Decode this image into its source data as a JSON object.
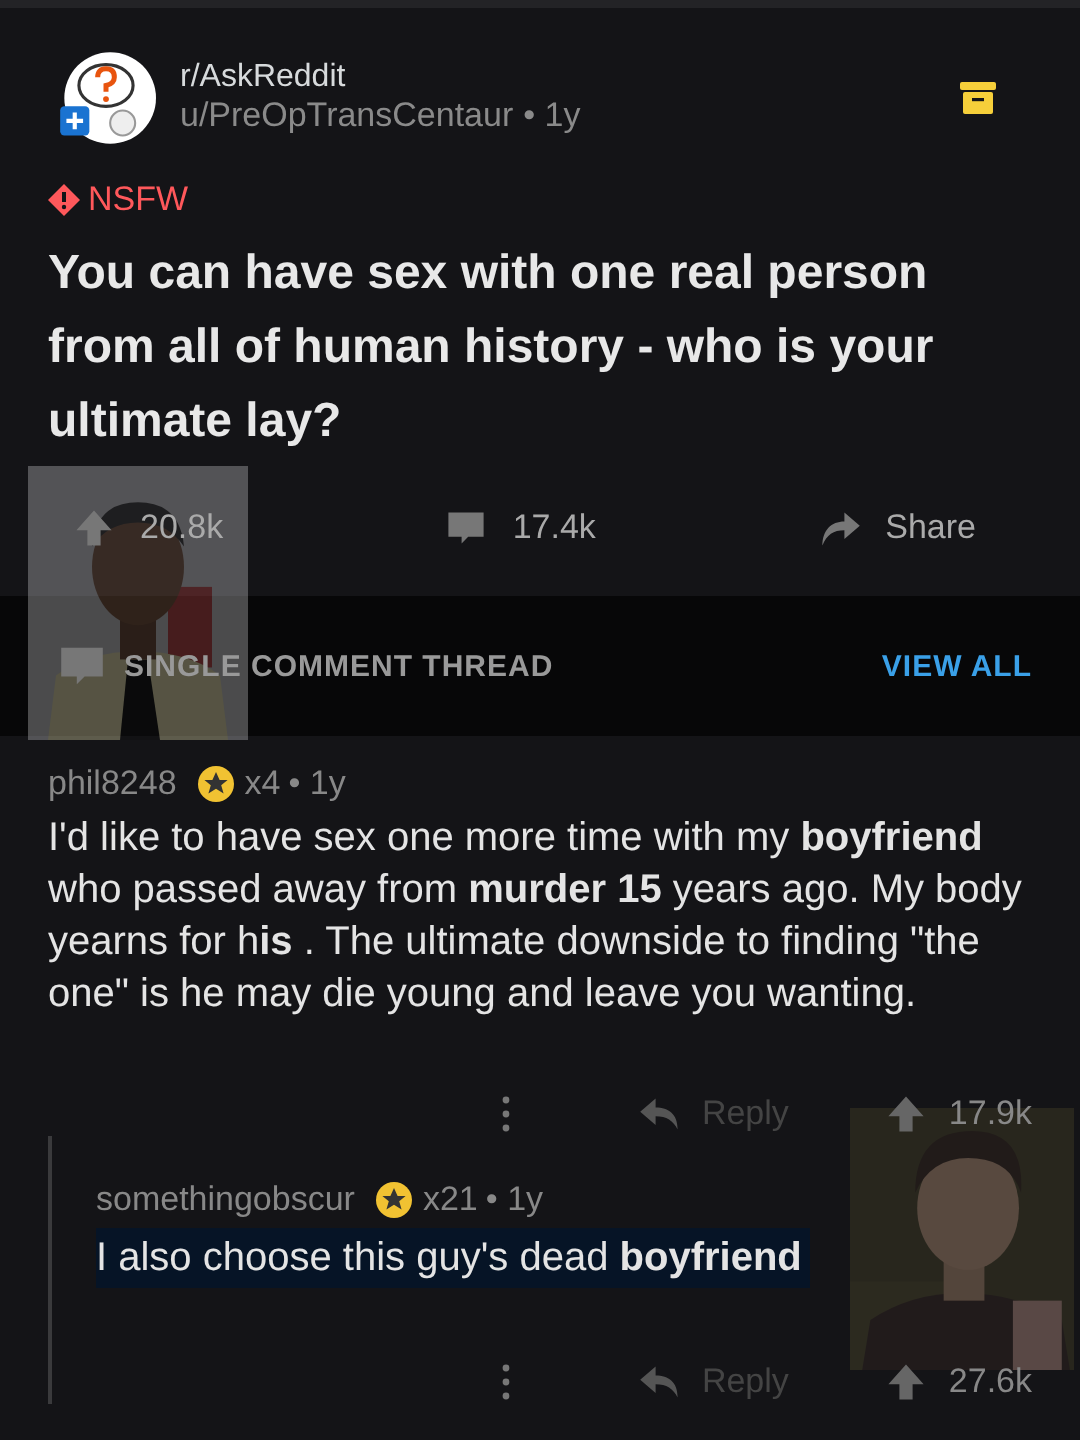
{
  "post": {
    "subreddit": "r/AskReddit",
    "author": "u/PreOpTransCentaur",
    "age": "• 1y",
    "nsfw": "NSFW",
    "title": "You can have sex with one real person from all of human history - who is your ultimate lay?",
    "votes": "20.8k",
    "comments": "17.4k",
    "share": "Share"
  },
  "thread_bar": {
    "label": "SINGLE COMMENT THREAD",
    "view_all": "VIEW ALL"
  },
  "comments": [
    {
      "user": "phil8248",
      "awards": "x4",
      "age": "• 1y",
      "body": "I'd like to have sex one more time with my **boyfriend** who passed away from **murder 15** years ago. My body yearns for h**is**    . The ultimate downside to finding \"the one\" is    he may die young and leave you wanting.",
      "highlighted": false,
      "reply": "Reply",
      "votes": "17.9k",
      "nested": false
    },
    {
      "user": "somethingobscur",
      "awards": "x21",
      "age": "• 1y",
      "body": "I also choose this guy's dead **boyfriend**",
      "highlighted": true,
      "reply": "Reply",
      "votes": "27.6k",
      "nested": true
    }
  ]
}
